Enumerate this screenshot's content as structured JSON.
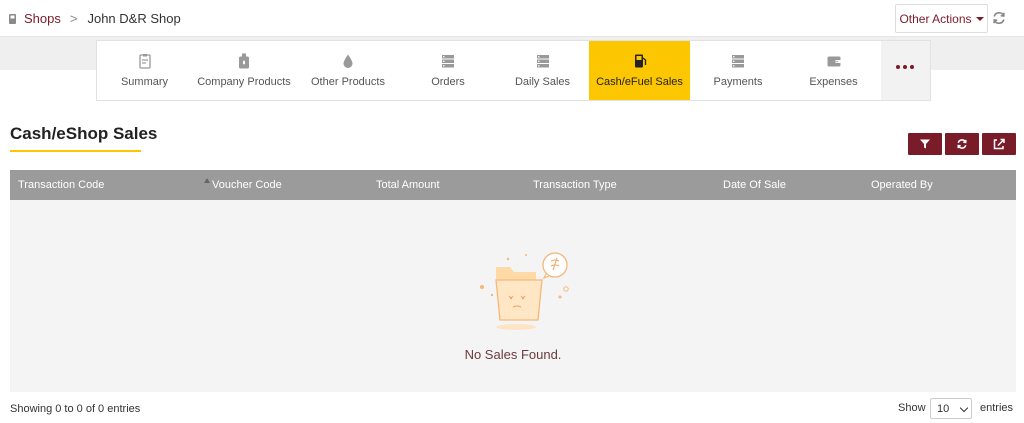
{
  "breadcrumb": {
    "root": "Shops",
    "separator": ">",
    "current": "John D&R Shop"
  },
  "header": {
    "other_actions": "Other Actions"
  },
  "tabs": [
    {
      "label": "Summary",
      "icon": "clipboard-icon"
    },
    {
      "label": "Company Products",
      "icon": "jerrycan-icon"
    },
    {
      "label": "Other Products",
      "icon": "droplet-icon"
    },
    {
      "label": "Orders",
      "icon": "server-icon"
    },
    {
      "label": "Daily Sales",
      "icon": "server-icon"
    },
    {
      "label": "Cash/eFuel Sales",
      "icon": "fuel-pump-icon",
      "active": true
    },
    {
      "label": "Payments",
      "icon": "server-icon"
    },
    {
      "label": "Expenses",
      "icon": "wallet-icon"
    }
  ],
  "section": {
    "title": "Cash/eShop Sales"
  },
  "table": {
    "columns": [
      "Transaction Code",
      "Voucher Code",
      "Total Amount",
      "Transaction Type",
      "Date Of Sale",
      "Operated By"
    ],
    "rows": [],
    "empty_message": "No Sales Found."
  },
  "footer": {
    "showing": "Showing 0 to 0 of 0 entries",
    "show_label": "Show",
    "page_size": "10",
    "entries_label": "entries"
  },
  "colors": {
    "brand": "#7a1b2a",
    "active_tab": "#fcc600",
    "table_header": "#9b9b9b"
  }
}
